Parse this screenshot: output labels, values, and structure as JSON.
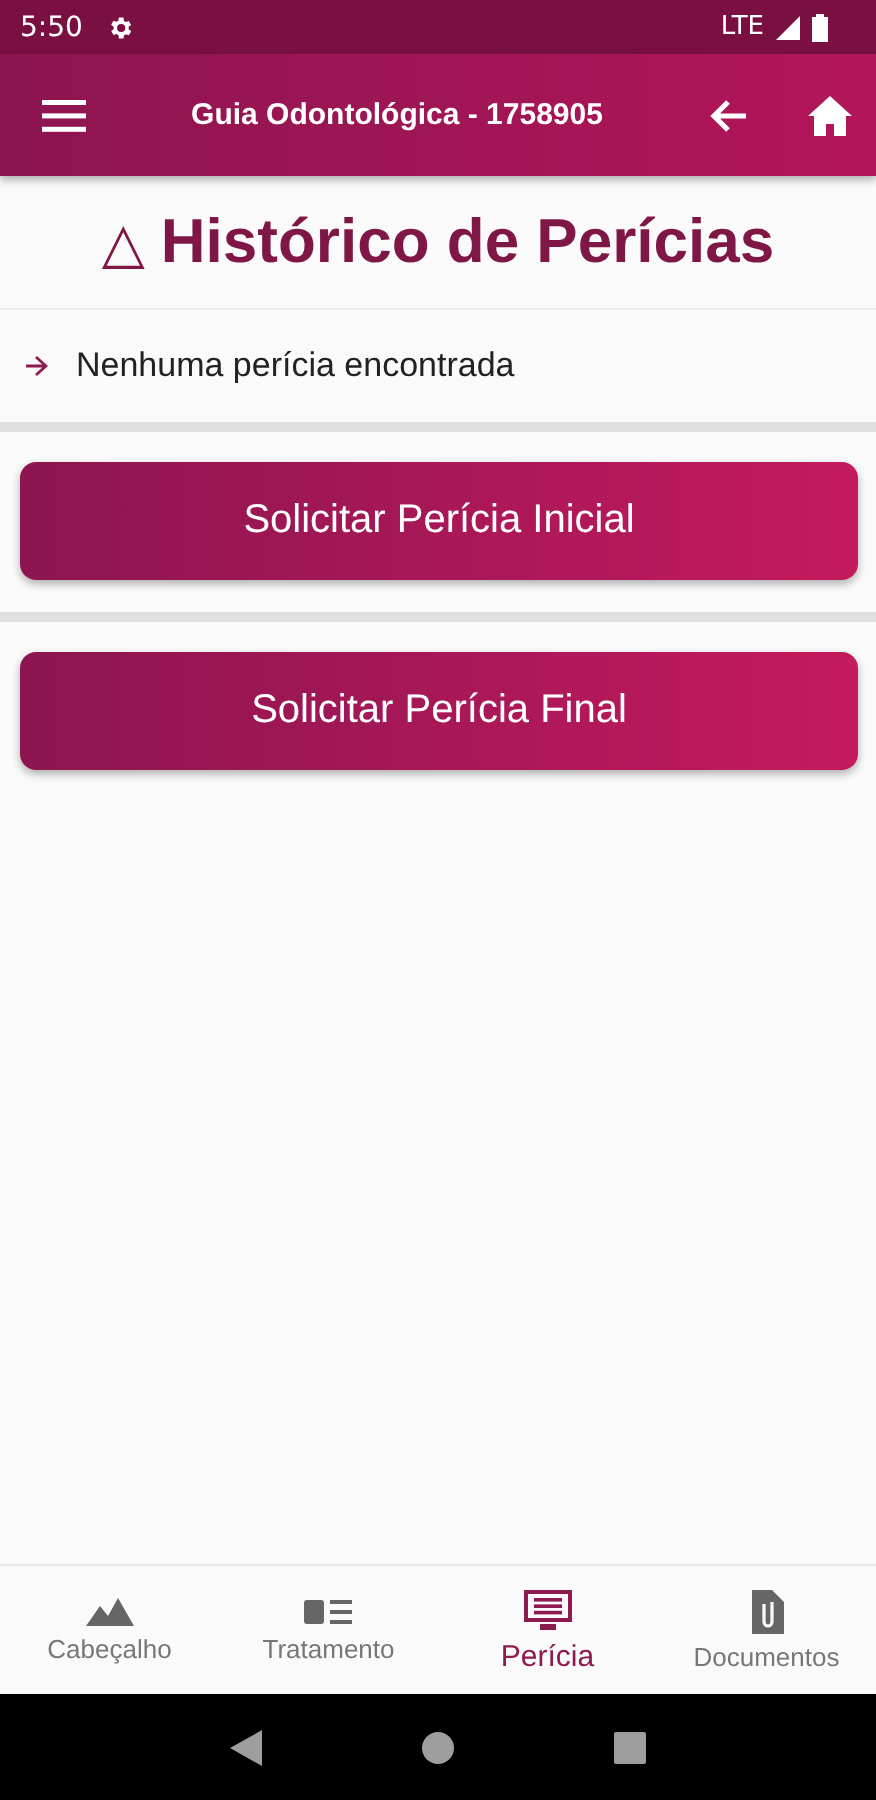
{
  "status_bar": {
    "time": "5:50",
    "network": "LTE"
  },
  "app_bar": {
    "title": "Guia Odontológica - 1758905"
  },
  "heading": {
    "icon": "△",
    "title": "Histórico de Perícias"
  },
  "history": {
    "empty_message": "Nenhuma perícia encontrada"
  },
  "actions": [
    {
      "label": "Solicitar Perícia Inicial"
    },
    {
      "label": "Solicitar Perícia Final"
    }
  ],
  "bottom_nav": [
    {
      "label": "Cabeçalho",
      "selected": false
    },
    {
      "label": "Tratamento",
      "selected": false
    },
    {
      "label": "Perícia",
      "selected": true
    },
    {
      "label": "Documentos",
      "selected": false
    }
  ]
}
